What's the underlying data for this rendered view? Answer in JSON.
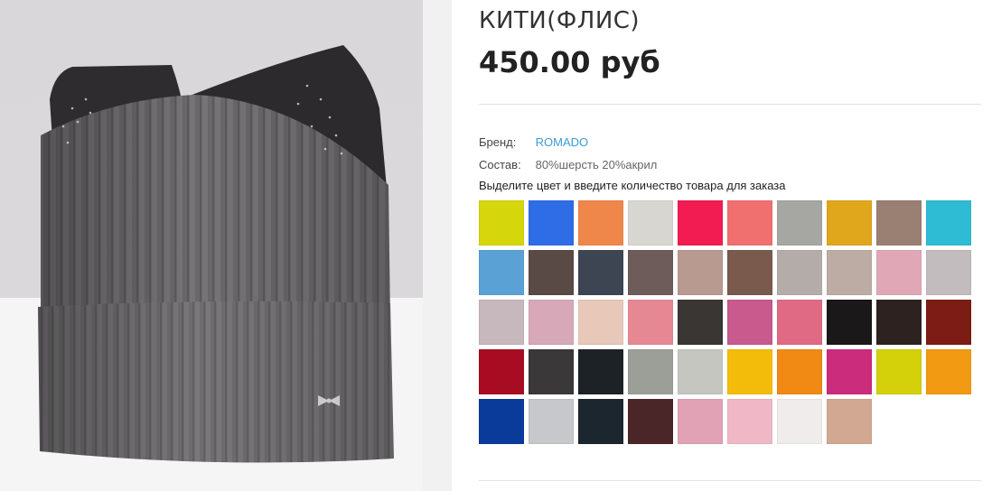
{
  "product": {
    "name": "КИТИ(ФЛИС)",
    "price": "450.00 руб",
    "brand_label": "Бренд:",
    "brand_value": "ROMADO",
    "composition_label": "Состав:",
    "composition_value": "80%шерсть 20%акрил",
    "instruction": "Выделите цвет и введите количество товара для заказа"
  },
  "swatch_colors": [
    "#d6d60c",
    "#2f6de6",
    "#f0874a",
    "#d8d6d0",
    "#f21c52",
    "#f07070",
    "#a6a6a2",
    "#e0a61c",
    "#9a8072",
    "#2ebcd4",
    "#5aa2d6",
    "#5a4a46",
    "#3e4552",
    "#6e5c5a",
    "#b89a90",
    "#7a5a4c",
    "#b4aca8",
    "#bcaca4",
    "#e0a8b6",
    "#c2bcbe",
    "#c6b8bc",
    "#d6a8b8",
    "#e8c8b8",
    "#e68894",
    "#3a3634",
    "#c85a8e",
    "#e06a84",
    "#1a1818",
    "#2e2220",
    "#7c1c14",
    "#a80c22",
    "#3a3838",
    "#1c2226",
    "#9c9e98",
    "#c6c6c0",
    "#f4bc0a",
    "#f08a14",
    "#cc2c7c",
    "#d4d00a",
    "#f29a12",
    "#0a3a9a",
    "#c6c8cc",
    "#1c262e",
    "#4a2628",
    "#e2a2b6",
    "#f0b8c6",
    "#f0ecec",
    "#d2a892"
  ]
}
